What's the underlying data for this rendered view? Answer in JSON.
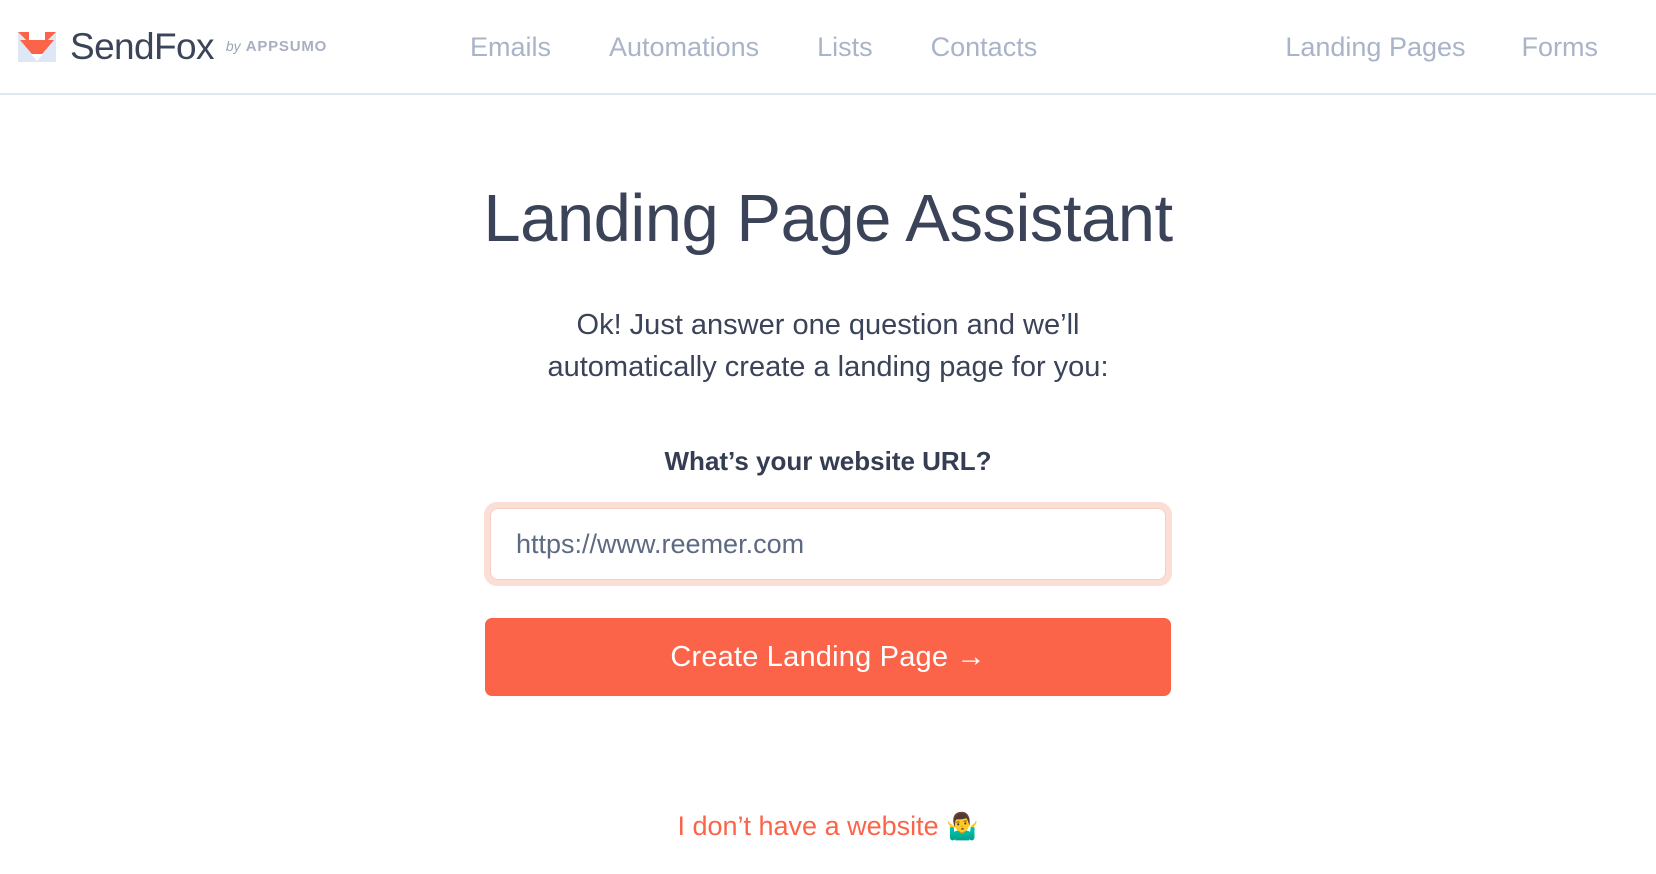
{
  "header": {
    "brand": {
      "name": "SendFox",
      "by_label": "by",
      "parent_company": "AppSumo",
      "logo_icon": "sendfox-fox-envelope-icon"
    },
    "nav_left": [
      {
        "label": "Emails"
      },
      {
        "label": "Automations"
      },
      {
        "label": "Lists"
      },
      {
        "label": "Contacts"
      }
    ],
    "nav_right": [
      {
        "label": "Landing Pages"
      },
      {
        "label": "Forms"
      }
    ]
  },
  "main": {
    "title": "Landing Page Assistant",
    "subtitle": "Ok! Just answer one question and we’ll automatically create a landing page for you:",
    "question": "What’s your website URL?",
    "url_input": {
      "value": "",
      "placeholder": "https://www.reemer.com"
    },
    "submit_label": "Create Landing Page →",
    "no_website_label": "I don’t have a website",
    "no_website_emoji": "🤷‍♂️"
  },
  "colors": {
    "accent": "#fc6449",
    "title_text": "#3a4358",
    "nav_text": "#a9b4c9",
    "focus_ring": "#fbdfd7",
    "header_border": "#dfe7f0",
    "background": "#ffffff"
  }
}
